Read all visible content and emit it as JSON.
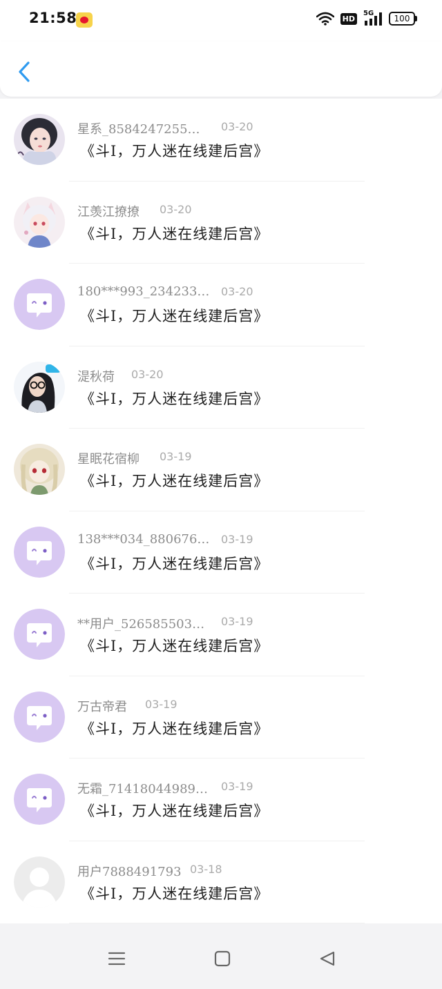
{
  "status_bar": {
    "time": "21:58",
    "network": "HD",
    "signal": "5G",
    "battery": "100"
  },
  "header": {
    "back_icon": "chevron-left-icon",
    "accent_color": "#2f9bf0"
  },
  "comments": [
    {
      "username": "星系_8584247255…",
      "date": "03-20",
      "message": "《斗I，万人迷在线建后宫》",
      "avatar": "photo-girl-dark-hair"
    },
    {
      "username": "江羡江撩撩",
      "date": "03-20",
      "message": "《斗I，万人迷在线建后宫》",
      "avatar": "photo-anime-girl-white-hair"
    },
    {
      "username": "180***993_234233…",
      "date": "03-20",
      "message": "《斗I，万人迷在线建后宫》",
      "avatar": "default-chat-bubble"
    },
    {
      "username": "湜秋荷",
      "date": "03-20",
      "message": "《斗I，万人迷在线建后宫》",
      "avatar": "photo-girl-glasses"
    },
    {
      "username": "星眠花宿柳",
      "date": "03-19",
      "message": "《斗I，万人迷在线建后宫》",
      "avatar": "photo-anime-blonde"
    },
    {
      "username": "138***034_880676…",
      "date": "03-19",
      "message": "《斗I，万人迷在线建后宫》",
      "avatar": "default-chat-bubble"
    },
    {
      "username": "**用户_526585503…",
      "date": "03-19",
      "message": "《斗I，万人迷在线建后宫》",
      "avatar": "default-chat-bubble"
    },
    {
      "username": "万古帝君",
      "date": "03-19",
      "message": "《斗I，万人迷在线建后宫》",
      "avatar": "default-chat-bubble"
    },
    {
      "username": "无霜_71418044989…",
      "date": "03-19",
      "message": "《斗I，万人迷在线建后宫》",
      "avatar": "default-chat-bubble"
    },
    {
      "username": "用户7888491793",
      "date": "03-18",
      "message": "《斗I，万人迷在线建后宫》",
      "avatar": "default-person-gray"
    }
  ],
  "nav_bar": {
    "menu_icon": "menu-icon",
    "home_icon": "home-square-icon",
    "back_icon": "back-triangle-icon"
  }
}
